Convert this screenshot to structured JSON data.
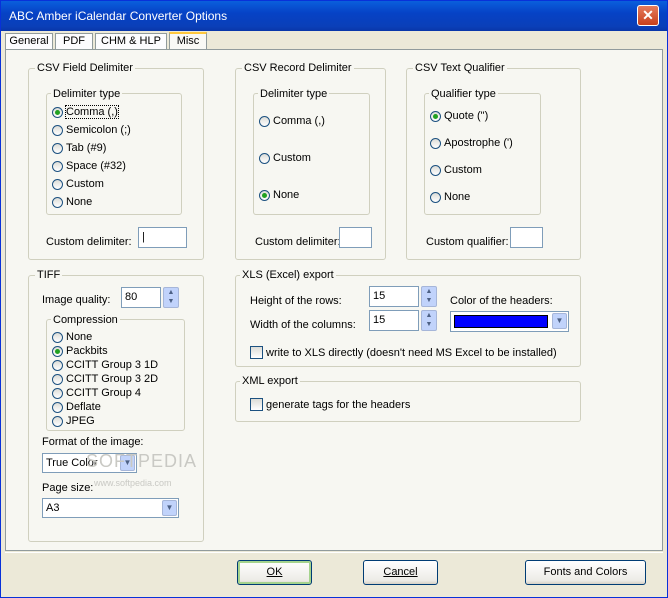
{
  "window": {
    "title": "ABC Amber iCalendar Converter Options",
    "close": "✕"
  },
  "tabs": [
    {
      "label": "General"
    },
    {
      "label": "PDF"
    },
    {
      "label": "CHM & HLP"
    },
    {
      "label": "Misc"
    }
  ],
  "csv_field": {
    "title": "CSV Field Delimiter",
    "inner_title": "Delimiter type",
    "options": [
      "Comma (,)",
      "Semicolon (;)",
      "Tab (#9)",
      "Space (#32)",
      "Custom",
      "None"
    ],
    "selected": 0,
    "custom_label": "Custom delimiter:",
    "custom_value": "|"
  },
  "csv_record": {
    "title": "CSV Record Delimiter",
    "inner_title": "Delimiter type",
    "options": [
      "Comma (,)",
      "Custom",
      "None"
    ],
    "selected": 2,
    "custom_label": "Custom delimiter:",
    "custom_value": ""
  },
  "csv_qualifier": {
    "title": "CSV Text Qualifier",
    "inner_title": "Qualifier type",
    "options": [
      "Quote (\")",
      "Apostrophe (')",
      "Custom",
      "None"
    ],
    "selected": 0,
    "custom_label": "Custom qualifier:",
    "custom_value": ""
  },
  "tiff": {
    "title": "TIFF",
    "quality_label": "Image quality:",
    "quality_value": "80",
    "compression_title": "Compression",
    "compression_options": [
      "None",
      "Packbits",
      "CCITT Group 3 1D",
      "CCITT Group 3 2D",
      "CCITT Group 4",
      "Deflate",
      "JPEG"
    ],
    "compression_selected": 1,
    "format_label": "Format of the image:",
    "format_value": "True Color",
    "page_size_label": "Page size:",
    "page_size_value": "A3"
  },
  "xls": {
    "title": "XLS (Excel) export",
    "row_height_label": "Height of the rows:",
    "row_height_value": "15",
    "col_width_label": "Width of the columns:",
    "col_width_value": "15",
    "header_color_label": "Color of the headers:",
    "header_color": "#0000ff",
    "direct_label": "write to XLS directly (doesn't need MS Excel to be installed)",
    "direct_checked": false
  },
  "xml": {
    "title": "XML export",
    "tags_label": "generate tags for the headers",
    "tags_checked": false
  },
  "buttons": {
    "ok": "OK",
    "cancel": "Cancel",
    "fonts": "Fonts and Colors"
  },
  "watermark": {
    "text": "SOFTPEDIA",
    "sub": "www.softpedia.com"
  }
}
